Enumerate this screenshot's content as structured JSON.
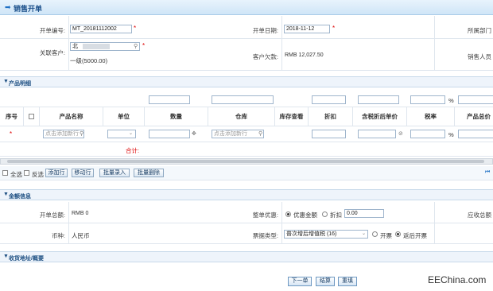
{
  "title": "销售开单",
  "header": {
    "order_no_label": "开单编号:",
    "order_no_value": "MT_20181112002",
    "order_date_label": "开单日期:",
    "order_date_value": "2018-11-12",
    "dept_label": "所属部门",
    "customer_label": "关联客户:",
    "customer_value": "北",
    "customer_level": "一级(5000.00)",
    "debt_label": "客户欠款:",
    "debt_value": "RMB 12,027.50",
    "sales_label": "销售人员"
  },
  "products": {
    "section_title": "产品明细",
    "percent": "%",
    "columns": [
      "序号",
      "产品名称",
      "单位",
      "数量",
      "仓库",
      "库存查看",
      "折扣",
      "含税折后单价",
      "税率",
      "产品总价"
    ],
    "row": {
      "marker": "*",
      "product_placeholder": "点击添加新行",
      "warehouse_placeholder": "点击添加新行",
      "percent": "%"
    },
    "total_label": "合计:",
    "toolbar": {
      "select_all": "全选",
      "invert": "反选",
      "add_row": "添加行",
      "move_row": "移动行",
      "batch_import": "批量录入",
      "batch_delete": "批量删除"
    }
  },
  "amount": {
    "section_title": "金额信息",
    "total_label": "开单总额:",
    "total_value": "RMB 0",
    "discount_label": "整单优惠:",
    "discount_opt1": "优惠金额",
    "discount_opt2": "折扣",
    "discount_value": "0.00",
    "receivable_label": "应收总额",
    "currency_label": "币种:",
    "currency_value": "人民币",
    "invoice_label": "票据类型:",
    "invoice_value": "普次增后增值税 (16)",
    "invoice_opt1": "开票",
    "invoice_opt2": "返后开票"
  },
  "shipping": {
    "section_title": "收货地址/概要"
  },
  "nav": {
    "next": "下一单",
    "settle": "结算",
    "reset": "重填"
  },
  "watermark": "EEChina.com"
}
